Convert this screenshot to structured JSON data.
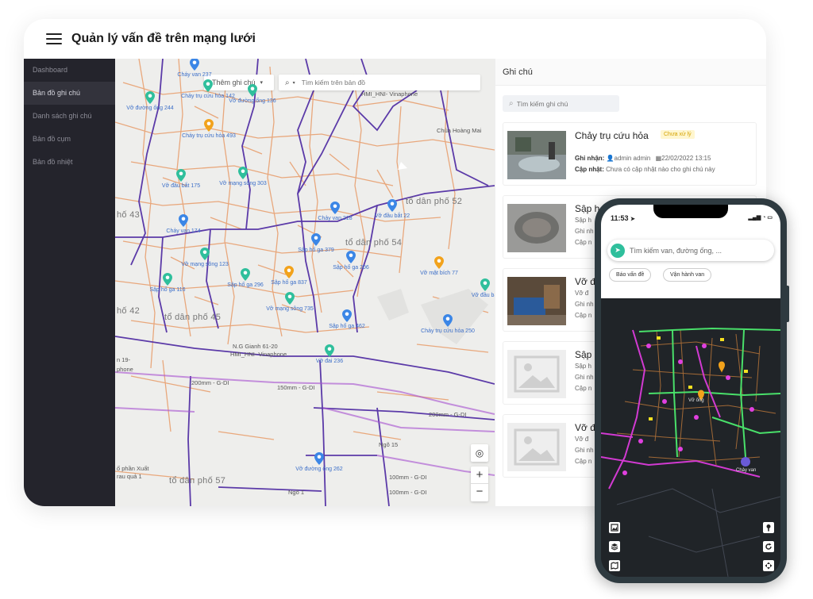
{
  "header": {
    "title": "Quản lý vấn đề trên mạng lưới"
  },
  "sidebar": {
    "items": [
      {
        "label": "Dashboard"
      },
      {
        "label": "Bản đồ ghi chú"
      },
      {
        "label": "Danh sách ghi chú"
      },
      {
        "label": "Bản đồ cụm"
      },
      {
        "label": "Bản đồ nhiệt"
      }
    ],
    "active_index": 1
  },
  "map": {
    "add_note_label": "Thêm ghi chú",
    "search_placeholder": "Tìm kiếm trên bản đồ",
    "pins": [
      {
        "label": "Cháy van 237",
        "color": "#3b86e6"
      },
      {
        "label": "Chảy trụ cứu hỏa 142",
        "color": "#2fbf9c"
      },
      {
        "label": "Vỡ đường ống 244",
        "color": "#2fbf9c"
      },
      {
        "label": "Vỡ đường ống 136",
        "color": "#2fbf9c"
      },
      {
        "label": "Chảy trụ cứu hỏa 493",
        "color": "#f2a21b"
      },
      {
        "label": "Vỡ đầu bắt 175",
        "color": "#2fbf9c"
      },
      {
        "label": "Vỡ mạng sông 303",
        "color": "#2fbf9c"
      },
      {
        "label": "Chảy van 218",
        "color": "#3b86e6"
      },
      {
        "label": "Vỡ đầu bắt 22",
        "color": "#3b86e6"
      },
      {
        "label": "Chảy van 174",
        "color": "#3b86e6"
      },
      {
        "label": "Sập hố ga 379",
        "color": "#3b86e6"
      },
      {
        "label": "Vỡ mạng sông 123",
        "color": "#2fbf9c"
      },
      {
        "label": "Sập hố ga 296",
        "color": "#2fbf9c"
      },
      {
        "label": "Sập hố ga 837",
        "color": "#f2a21b"
      },
      {
        "label": "Sập hố ga 206",
        "color": "#3b86e6"
      },
      {
        "label": "Vỡ mặt bích 77",
        "color": "#f2a21b"
      },
      {
        "label": "Vỡ đầu bắt",
        "color": "#2fbf9c"
      },
      {
        "label": "Sập hố ga 116",
        "color": "#2fbf9c"
      },
      {
        "label": "Vỡ mạng sông 735",
        "color": "#2fbf9c"
      },
      {
        "label": "Sập hố ga 462",
        "color": "#3b86e6"
      },
      {
        "label": "Chảy trụ cứu hỏa 250",
        "color": "#3b86e6"
      },
      {
        "label": "Vỡ đai 236",
        "color": "#2fbf9c"
      },
      {
        "label": "Vỡ đường ống 262",
        "color": "#3b86e6"
      }
    ],
    "road_labels": [
      "HMI_HNI- Vinaphone",
      "Chùa Hoàng Mai",
      "HMI_HNI- Vinaphone",
      "N.G Gianh 61-20",
      "200mm - G-DI",
      "150mm - G-DI",
      "200mm - G-DI",
      "100mm - G-DI",
      "100mm - G-DI",
      "Ngõ 15",
      "Ngõ 1",
      "ố phần Xuất",
      "rau quả 1",
      "n 19-",
      "phone"
    ],
    "area_labels": [
      "tổ dân phố 52",
      "tổ dân phố 54",
      "tổ dân phố 45",
      "tổ dân phố 57",
      "hố 43",
      "hố 42"
    ]
  },
  "notes": {
    "title": "Ghi chú",
    "search_placeholder": "Tìm kiếm ghi chú",
    "cards": [
      {
        "title": "Chảy trụ cứu hỏa",
        "badge": "Chưa xử lý",
        "recorded_label": "Ghi nhận:",
        "recorder": "admin admin",
        "date": "22/02/2022 13:15",
        "update_label": "Cập nhật:",
        "update_text": "Chưa có cập nhật nào cho ghi chú này"
      },
      {
        "title": "Sập h",
        "line1": "Sập h",
        "line2": "Ghi nh",
        "line3": "Cập n"
      },
      {
        "title": "Vỡ đ",
        "line1": "Vỡ đ",
        "line2": "Ghi nh",
        "line3": "Cập n"
      },
      {
        "title": "Sập h",
        "line1": "Sập h",
        "line2": "Ghi nh",
        "line3": "Cập n"
      },
      {
        "title": "Vỡ đ",
        "line1": "Vỡ đ",
        "line2": "Ghi nh",
        "line3": "Cập n"
      }
    ]
  },
  "phone": {
    "time": "11:53",
    "search_placeholder": "Tìm kiếm van, đường ống, ...",
    "chips": [
      "Báo vấn đề",
      "Vận hành van"
    ],
    "map_labels": [
      "Vỡ ống",
      "Chảy van"
    ]
  }
}
